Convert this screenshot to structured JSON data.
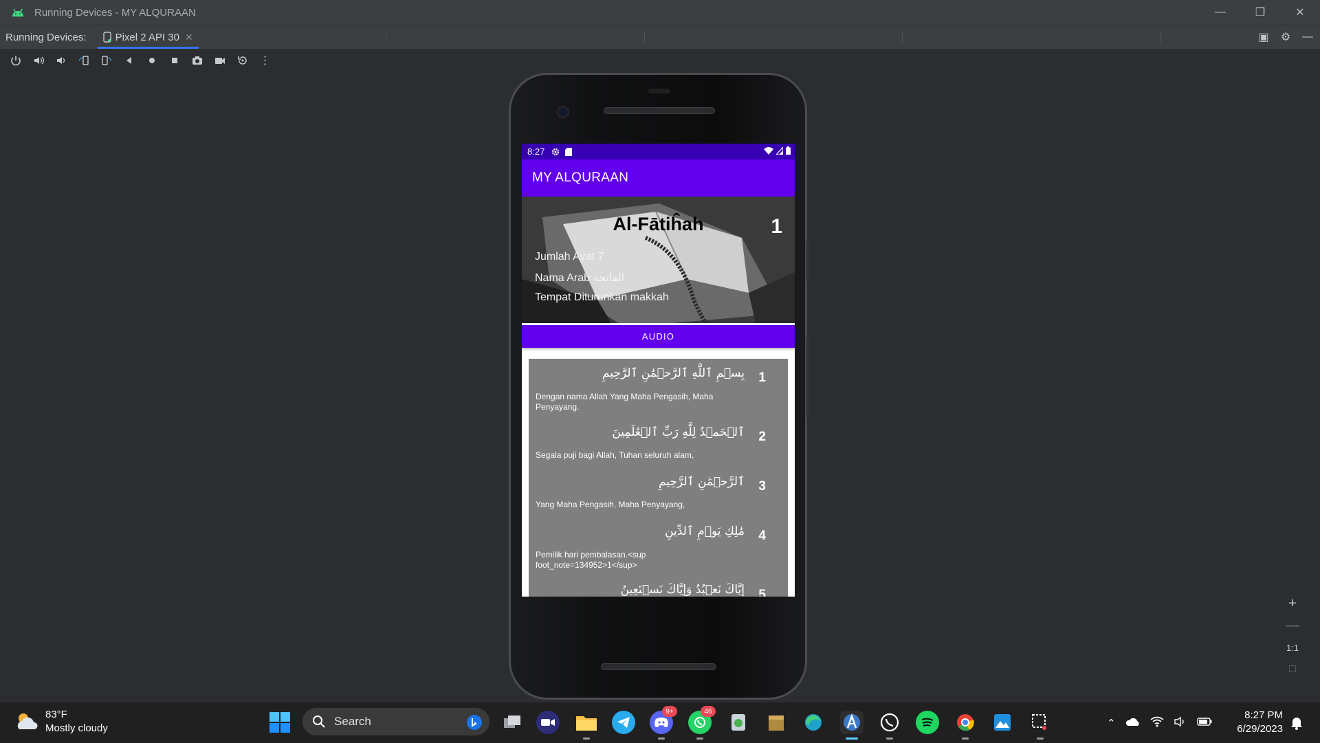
{
  "window": {
    "title": "Running Devices - MY ALQURAAN",
    "controls": [
      "minimize-icon",
      "restore-icon",
      "close-icon"
    ]
  },
  "tabs": {
    "label": "Running Devices:",
    "device_tab": "Pixel 2 API 30"
  },
  "toolbar": {
    "icons": [
      "power-icon",
      "volume-up-icon",
      "volume-down-icon",
      "rotate-left-icon",
      "rotate-right-icon",
      "back-icon",
      "home-icon",
      "overview-icon",
      "screenshot-icon",
      "screen-record-icon",
      "reset-icon",
      "more-options-icon"
    ]
  },
  "device": {
    "status_bar": {
      "time": "8:27"
    },
    "app_bar": {
      "title": "MY ALQURAAN"
    },
    "surah": {
      "name": "Al-Fātiĥah",
      "number": "1",
      "jumlah_ayat": "Jumlah Ayat 7",
      "nama_arab": "Nama Arab الفاتحة",
      "tempat": "Tempat Diturunkan makkah"
    },
    "audio_button": "AUDIO",
    "ayat": [
      {
        "number": "1",
        "arabic": "بِسۡمِ ٱللَّهِ ٱلرَّحۡمَٰنِ ٱلرَّحِيمِ",
        "translation": "Dengan nama Allah Yang Maha Pengasih, Maha Penyayang."
      },
      {
        "number": "2",
        "arabic": "ٱلۡحَمۡدُ لِلَّهِ رَبِّ ٱلۡعَٰلَمِينَ",
        "translation": "Segala puji bagi Allah, Tuhan seluruh alam,"
      },
      {
        "number": "3",
        "arabic": "ٱلرَّحۡمَٰنِ ٱلرَّحِيمِ",
        "translation": "Yang Maha Pengasih, Maha Penyayang,"
      },
      {
        "number": "4",
        "arabic": "مَٰلِكِ يَوۡمِ ٱلدِّينِ",
        "translation": "Pemilik hari pembalasan.<sup foot_note=134952>1</sup>"
      },
      {
        "number": "5",
        "arabic": "إِيَّاكَ نَعۡبُدُ وَإِيَّاكَ نَسۡتَعِينُ",
        "translation": ""
      }
    ]
  },
  "zoom_controls": {
    "actual_size": "1:1"
  },
  "taskbar": {
    "weather": {
      "temp": "83°F",
      "condition": "Mostly cloudy"
    },
    "search_label": "Search",
    "apps": [
      {
        "name": "task-view",
        "badge": ""
      },
      {
        "name": "zoom",
        "badge": ""
      },
      {
        "name": "file-explorer",
        "badge": ""
      },
      {
        "name": "telegram",
        "badge": ""
      },
      {
        "name": "discord",
        "badge": "9+"
      },
      {
        "name": "whatsapp",
        "badge": "46"
      },
      {
        "name": "installer",
        "badge": ""
      },
      {
        "name": "winrar",
        "badge": ""
      },
      {
        "name": "edge",
        "badge": ""
      },
      {
        "name": "android-studio",
        "badge": ""
      },
      {
        "name": "whatsapp-desktop",
        "badge": ""
      },
      {
        "name": "spotify",
        "badge": ""
      },
      {
        "name": "chrome",
        "badge": ""
      },
      {
        "name": "photos",
        "badge": ""
      },
      {
        "name": "snipping-tool",
        "badge": ""
      }
    ],
    "clock": {
      "time": "8:27 PM",
      "date": "6/29/2023"
    }
  }
}
